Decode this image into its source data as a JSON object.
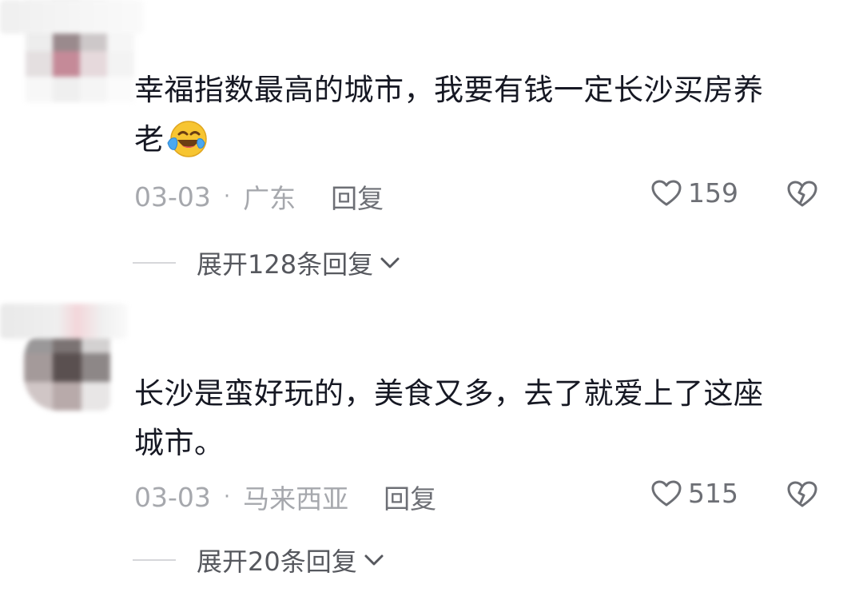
{
  "comments": [
    {
      "text_line1": "幸福指数最高的城市，我要有钱一定长沙买房养",
      "text_line2": "老",
      "emoji": "crying-laughing-emoji",
      "date": "03-03",
      "separator": "·",
      "location": "广东",
      "reply_label": "回复",
      "like_count": "159",
      "expand_label": "展开128条回复"
    },
    {
      "text_line1": "长沙是蛮好玩的，美食又多，去了就爱上了这座",
      "text_line2": "城市。",
      "date": "03-03",
      "separator": "·",
      "location": "马来西亚",
      "reply_label": "回复",
      "like_count": "515",
      "expand_label": "展开20条回复"
    }
  ],
  "icons": {
    "like": "heart-outline-icon",
    "dislike": "broken-heart-icon",
    "expand": "chevron-down-icon"
  },
  "colors": {
    "text": "#161823",
    "meta": "#a6a8ad",
    "action": "#6d6f75"
  }
}
